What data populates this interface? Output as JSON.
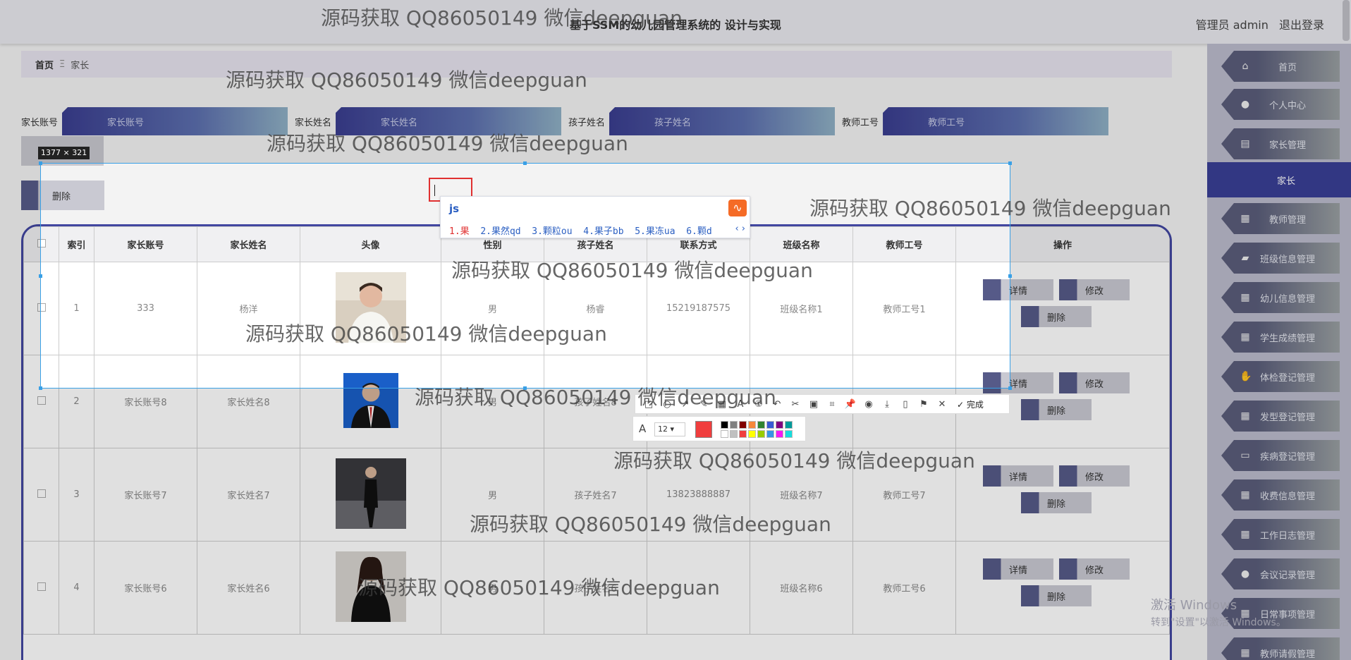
{
  "header": {
    "title": "基于SSM的幼儿园管理系统的 设计与实现",
    "admin_label": "管理员 admin",
    "logout_label": "退出登录"
  },
  "breadcrumb": {
    "home": "首页",
    "sep": "Ξ",
    "current": "家长"
  },
  "search": {
    "fields": [
      {
        "label": "家长账号",
        "placeholder": "家长账号"
      },
      {
        "label": "家长姓名",
        "placeholder": "家长姓名"
      },
      {
        "label": "孩子姓名",
        "placeholder": "孩子姓名"
      },
      {
        "label": "教师工号",
        "placeholder": "教师工号"
      }
    ],
    "delete_label": "删除"
  },
  "sidebar": {
    "items": [
      {
        "label": "首页",
        "icon": "home-icon"
      },
      {
        "label": "个人中心",
        "icon": "user-icon"
      },
      {
        "label": "家长管理",
        "icon": "clipboard-icon"
      },
      {
        "label": "家长",
        "icon": "",
        "active": true
      },
      {
        "label": "教师管理",
        "icon": "grid-icon"
      },
      {
        "label": "班级信息管理",
        "icon": "ticket-icon"
      },
      {
        "label": "幼儿信息管理",
        "icon": "grid-icon"
      },
      {
        "label": "学生成绩管理",
        "icon": "grid-icon"
      },
      {
        "label": "体检登记管理",
        "icon": "hand-icon"
      },
      {
        "label": "发型登记管理",
        "icon": "grid-icon"
      },
      {
        "label": "疾病登记管理",
        "icon": "monitor-icon"
      },
      {
        "label": "收费信息管理",
        "icon": "grid-icon"
      },
      {
        "label": "工作日志管理",
        "icon": "grid-icon"
      },
      {
        "label": "会议记录管理",
        "icon": "user-icon"
      },
      {
        "label": "日常事项管理",
        "icon": "grid-icon"
      },
      {
        "label": "教师请假管理",
        "icon": "grid-icon"
      }
    ]
  },
  "table": {
    "headers": [
      "",
      "索引",
      "家长账号",
      "家长姓名",
      "头像",
      "性别",
      "孩子姓名",
      "联系方式",
      "班级名称",
      "教师工号",
      "操作"
    ],
    "rows": [
      {
        "index": "1",
        "account": "333",
        "name": "杨洋",
        "gender": "男",
        "child": "杨睿",
        "phone": "15219187575",
        "class": "班级名称1",
        "teacher": "教师工号1"
      },
      {
        "index": "2",
        "account": "家长账号8",
        "name": "家长姓名8",
        "gender": "男",
        "child": "孩子姓名8",
        "phone": "",
        "class": "",
        "teacher": ""
      },
      {
        "index": "3",
        "account": "家长账号7",
        "name": "家长姓名7",
        "gender": "男",
        "child": "孩子姓名7",
        "phone": "13823888887",
        "class": "班级名称7",
        "teacher": "教师工号7"
      },
      {
        "index": "4",
        "account": "家长账号6",
        "name": "家长姓名6",
        "gender": "男",
        "child": "孩子姓名6",
        "phone": "",
        "class": "班级名称6",
        "teacher": "教师工号6"
      }
    ],
    "ops": {
      "detail": "详情",
      "edit": "修改",
      "delete": "删除"
    }
  },
  "capture": {
    "size_label": "1377 × 321",
    "ime_pinyin": "js",
    "ime_candidates": [
      "1.果",
      "2.果然qd",
      "3.颗粒ou",
      "4.果子bb",
      "5.果冻ua",
      "6.颗d"
    ],
    "font_size": "12",
    "done_label": "完成",
    "current_color": "#f03e3e",
    "swatches": [
      "#000000",
      "#808080",
      "#800000",
      "#f7883a",
      "#308430",
      "#385ad3",
      "#800080",
      "#009999",
      "#ffffff",
      "#c0c0c0",
      "#f03e3e",
      "#ffff00",
      "#99cc00",
      "#3894e4",
      "#f31bf3",
      "#16dcdc"
    ]
  },
  "watermark": "源码获取 QQ86050149 微信deepguan",
  "os": {
    "activate_title": "激活 Windows",
    "activate_hint": "转到\"设置\"以激活 Windows。"
  }
}
